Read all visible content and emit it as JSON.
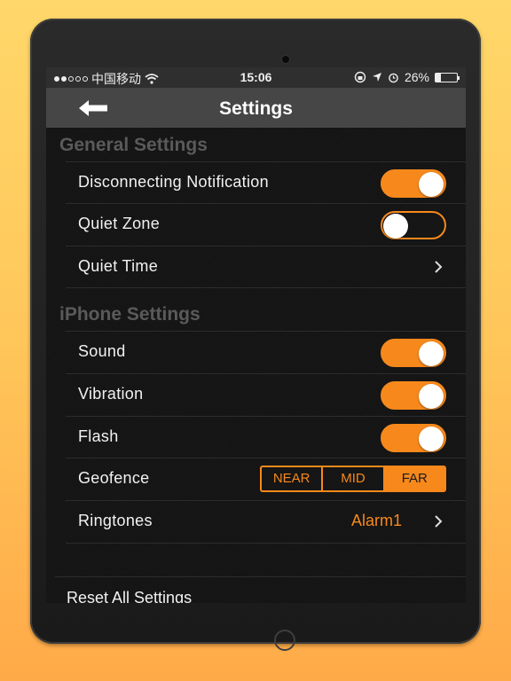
{
  "status_bar": {
    "carrier": "中国移动",
    "time": "15:06",
    "battery": "26%",
    "battery_level": 0.26
  },
  "nav": {
    "title": "Settings"
  },
  "sections": {
    "general": {
      "header": "General Settings",
      "disconnecting_notification": {
        "label": "Disconnecting Notification",
        "on": true
      },
      "quiet_zone": {
        "label": "Quiet Zone",
        "on": false
      },
      "quiet_time": {
        "label": "Quiet Time"
      }
    },
    "iphone": {
      "header": "iPhone Settings",
      "sound": {
        "label": "Sound",
        "on": true
      },
      "vibration": {
        "label": "Vibration",
        "on": true
      },
      "flash": {
        "label": "Flash",
        "on": true
      },
      "geofence": {
        "label": "Geofence",
        "options": [
          "NEAR",
          "MID",
          "FAR"
        ],
        "selected": "FAR"
      },
      "ringtones": {
        "label": "Ringtones",
        "value": "Alarm1"
      }
    }
  },
  "reset": {
    "label": "Reset All Settings"
  },
  "colors": {
    "accent": "#f7891c",
    "background": "#141414",
    "nav": "#464646"
  }
}
